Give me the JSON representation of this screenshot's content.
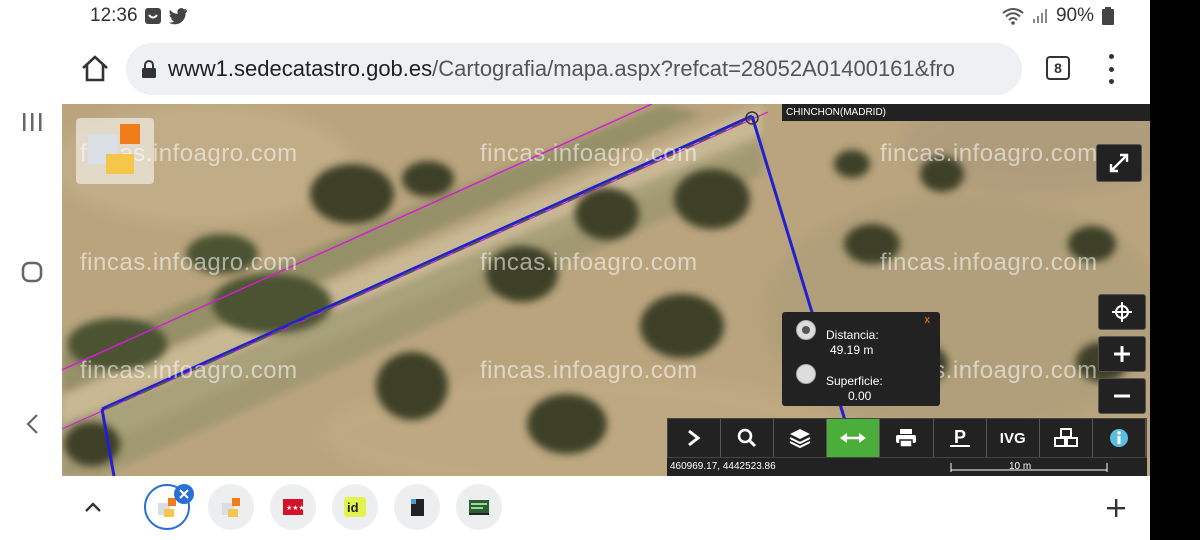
{
  "status": {
    "time": "12:36",
    "battery": "90%"
  },
  "browser": {
    "url_host": "www1.sedecatastro.gob.es",
    "url_path": "/Cartografia/mapa.aspx?refcat=28052A01400161&fro",
    "tab_count": "8"
  },
  "map": {
    "watermark": "fincas.infoagro.com",
    "municipio": "CHINCHON(MADRID)",
    "measure": {
      "distance_label": "Distancia:",
      "distance_value": "49.19 m",
      "area_label": "Superficie:",
      "area_value": "0.00",
      "close": "x",
      "selected": "distance"
    },
    "tools": [
      {
        "name": "expand-tool",
        "label": ""
      },
      {
        "name": "search-tool",
        "label": ""
      },
      {
        "name": "layers-tool",
        "label": ""
      },
      {
        "name": "measure-tool",
        "label": "",
        "active": true
      },
      {
        "name": "print-tool",
        "label": ""
      },
      {
        "name": "parking-tool",
        "label": ""
      },
      {
        "name": "ivg-tool",
        "label": "IVG"
      },
      {
        "name": "group-tool",
        "label": ""
      },
      {
        "name": "info-tool",
        "label": ""
      }
    ],
    "coordinates": "460969.17, 4442523.86",
    "scale": "10 m"
  },
  "colors": {
    "accent_green": "#4cae3a",
    "parcel_line": "#2020d0",
    "boundary_line": "#d020d0"
  }
}
